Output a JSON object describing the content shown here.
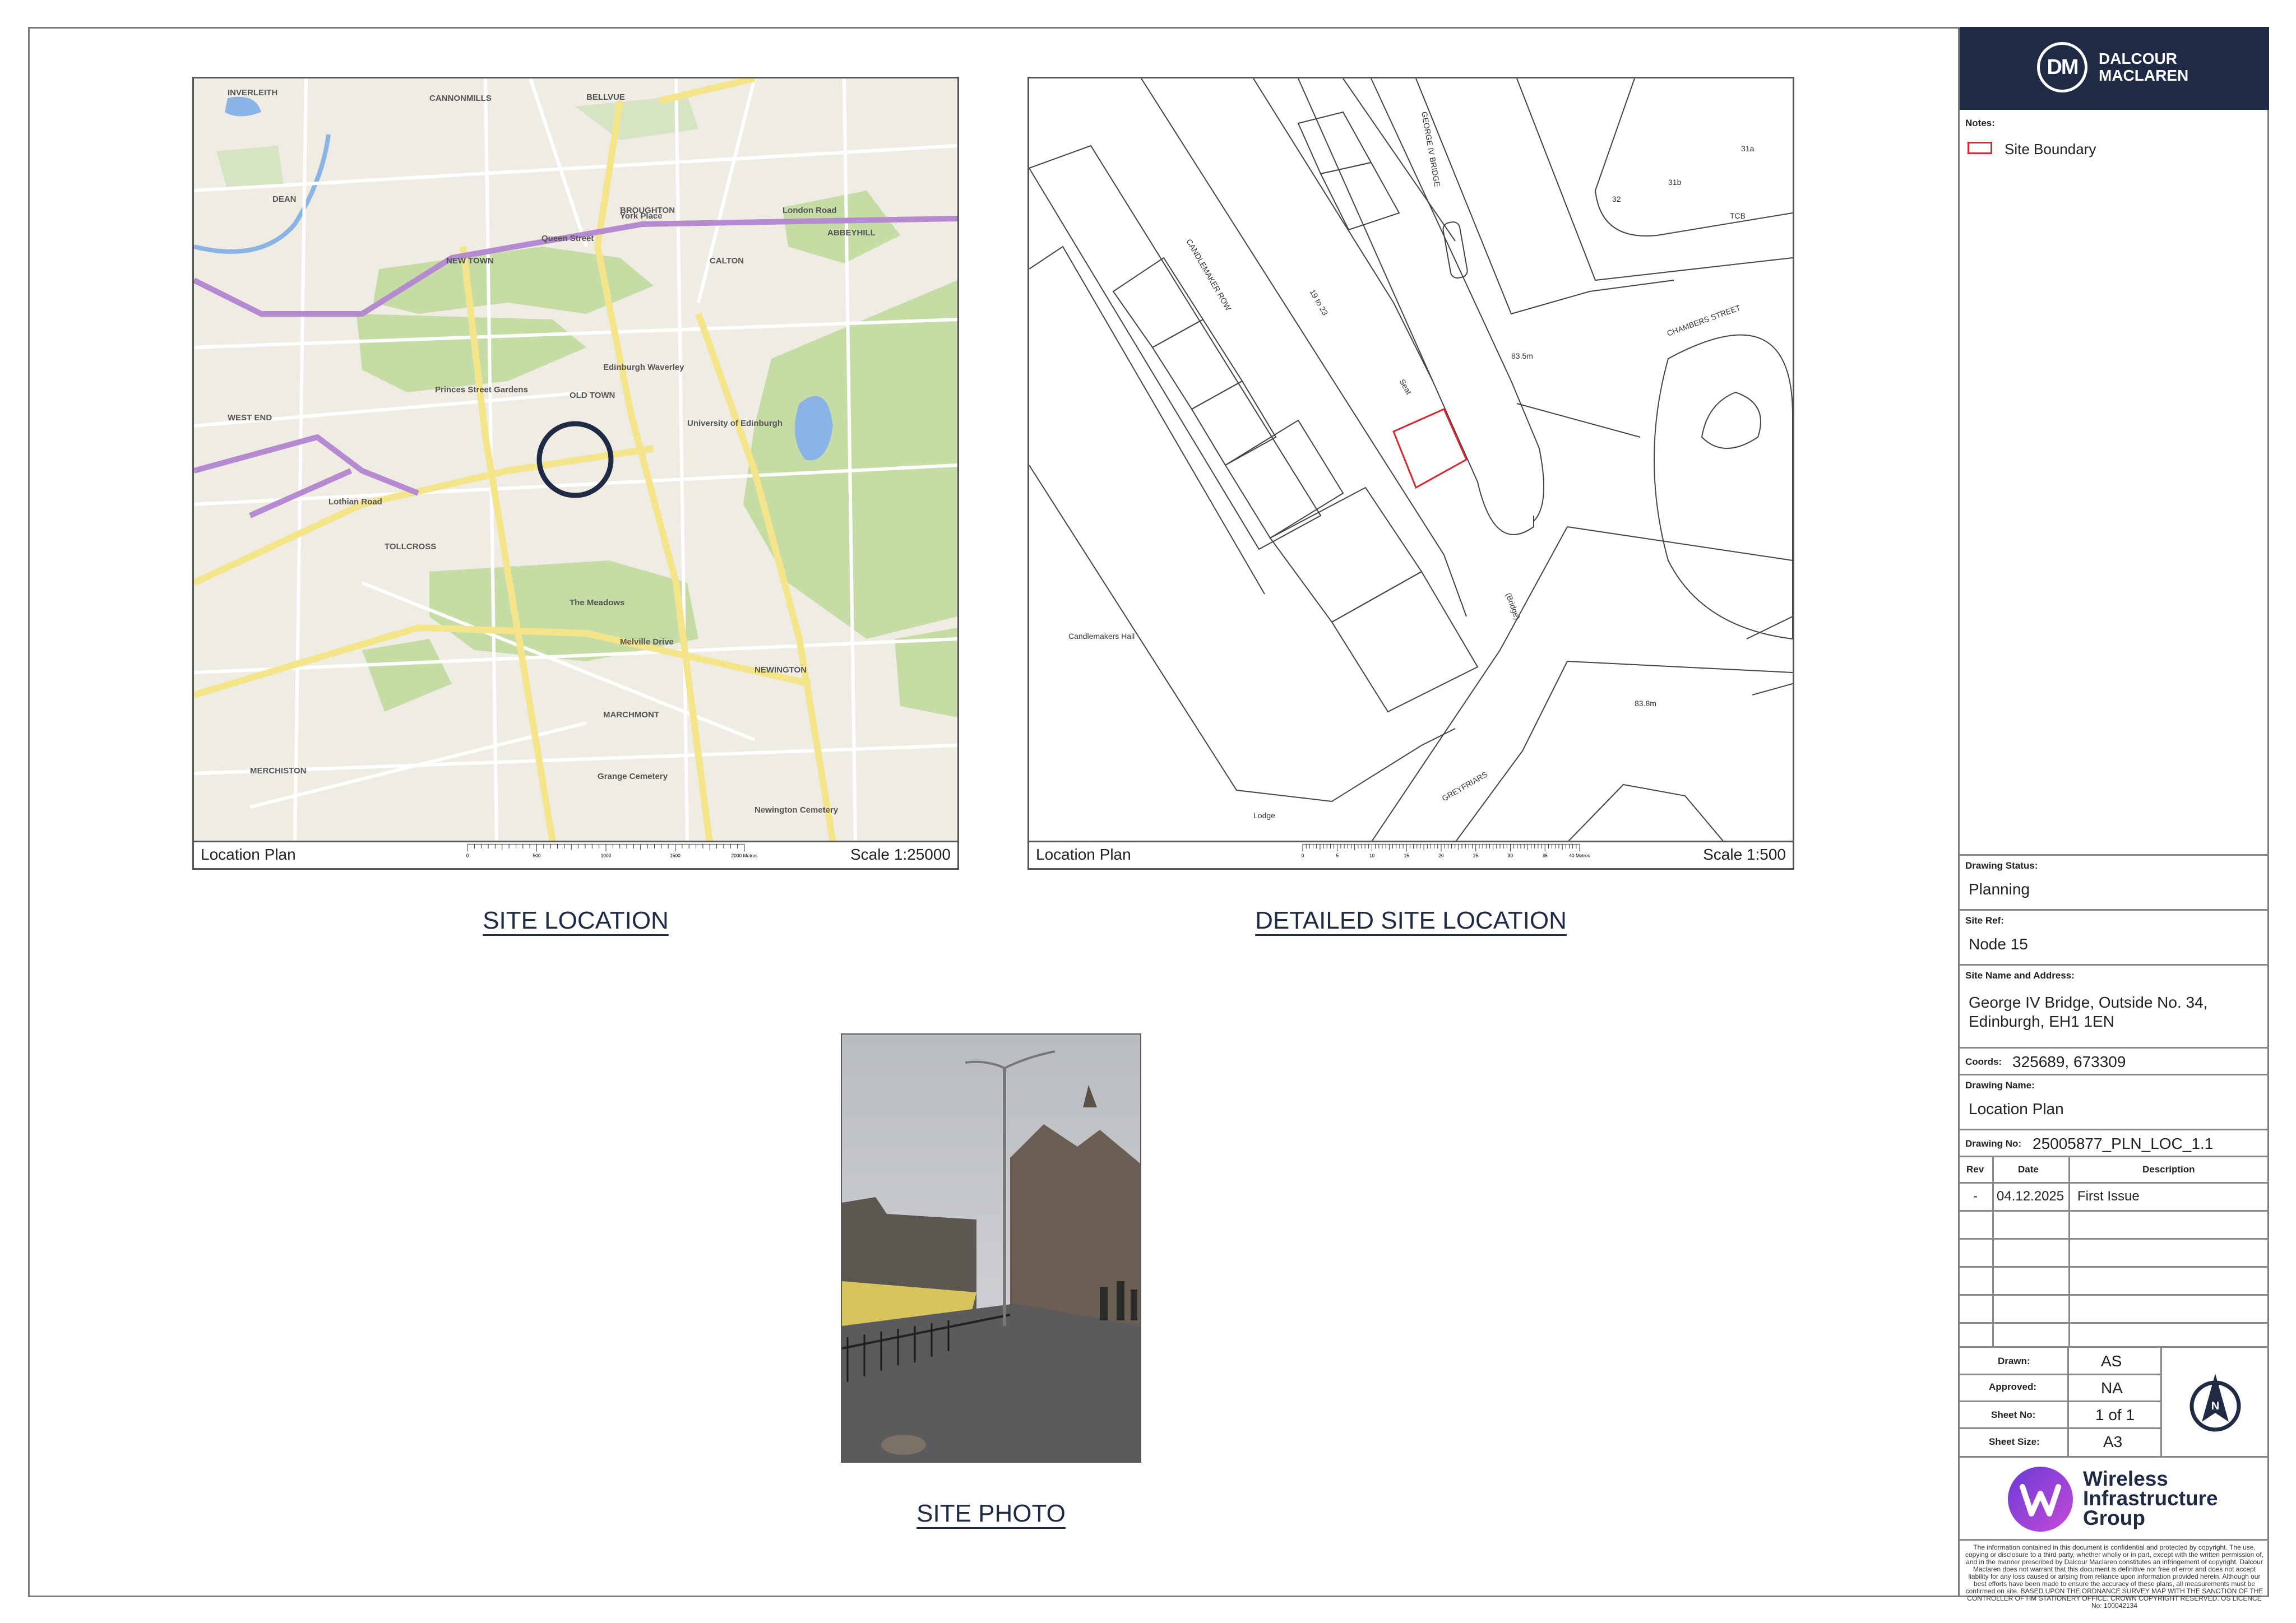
{
  "map_panel": {
    "footer_label": "Location Plan",
    "scale": "Scale 1:25000",
    "scalebar": {
      "ticks": [
        "0",
        "500",
        "1000",
        "1500",
        "2000 Metres"
      ]
    },
    "place_labels": [
      "INVERLEITH",
      "CANNONMILLS",
      "BELLVUE",
      "DEAN",
      "NEW TOWN",
      "BROUGHTON",
      "CALTON",
      "ABBEYHILL",
      "OLD TOWN",
      "WEST END",
      "TOLLCROSS",
      "MARCHMONT",
      "NEWINGTON",
      "MERCHISTON",
      "The Meadows",
      "Princes Street Gardens",
      "Edinburgh Waverley",
      "University of Edinburgh",
      "Queen Street",
      "York Place",
      "London Road",
      "Lothian Road",
      "Melville Drive",
      "Grange Cemetery",
      "Newington Cemetery"
    ]
  },
  "detail_panel": {
    "footer_label": "Location Plan",
    "scale": "Scale 1:500",
    "scalebar": {
      "ticks": [
        "0",
        "5",
        "10",
        "15",
        "20",
        "25",
        "30",
        "35",
        "40 Metres"
      ]
    },
    "labels": [
      "GEORGE IV BRIDGE",
      "CANDLEMAKER ROW",
      "CHAMBERS STREET",
      "GREYFRIARS",
      "Candlemakers Hall",
      "83.5m",
      "83.8m",
      "TCB",
      "Lodge",
      "(Bridge)",
      "31a",
      "31b",
      "32",
      "19 to 23",
      "Seat"
    ]
  },
  "captions": {
    "site_location": "SITE LOCATION",
    "detailed_site_location": "DETAILED SITE LOCATION",
    "site_photo": "SITE PHOTO"
  },
  "title_block": {
    "company": {
      "initials": "DM",
      "line1": "DALCOUR",
      "line2": "MACLAREN"
    },
    "notes_label": "Notes:",
    "legend": {
      "label": "Site Boundary",
      "color": "#d6282e"
    },
    "drawing_status_label": "Drawing Status:",
    "drawing_status": "Planning",
    "site_ref_label": "Site Ref:",
    "site_ref": "Node 15",
    "site_name_label": "Site Name and Address:",
    "site_name_line1": "George IV Bridge, Outside No. 34,",
    "site_name_line2": "Edinburgh, EH1 1EN",
    "coords_label": "Coords:",
    "coords": "325689, 673309",
    "drawing_name_label": "Drawing Name:",
    "drawing_name": "Location Plan",
    "drawing_no_label": "Drawing No:",
    "drawing_no": "25005877_PLN_LOC_1.1",
    "rev_headers": {
      "rev": "Rev",
      "date": "Date",
      "description": "Description"
    },
    "revisions": [
      {
        "rev": "-",
        "date": "04.12.2025",
        "description": "First Issue"
      }
    ],
    "drawn_label": "Drawn:",
    "drawn": "AS",
    "approved_label": "Approved:",
    "approved": "NA",
    "sheet_no_label": "Sheet No:",
    "sheet_no": "1 of 1",
    "sheet_size_label": "Sheet Size:",
    "sheet_size": "A3",
    "north_icon": "north-arrow-icon",
    "client": {
      "line1": "Wireless",
      "line2": "Infrastructure",
      "line3": "Group"
    },
    "legal_text": "The information contained in this document is confidential and protected by copyright. The use, copying or disclosure to a third party, whether wholly or in part, except with the written permission of, and in the manner prescribed by Dalcour Maclaren constitutes an infringement of copyright. Dalcour Maclaren does not warrant that this document is definitive nor free of error and does not accept liability for any loss caused or arising from reliance upon information provided herein. Although our best efforts have been made to ensure the accuracy of these plans, all measurements must be confirmed on site. BASED UPON THE ORDNANCE SURVEY MAP WITH THE SANCTION OF THE CONTROLLER OF HM STATIONERY OFFICE. CROWN COPYRIGHT RESERVED. OS LICENCE No: 100042134"
  },
  "colors": {
    "navy": "#1f2a44",
    "site_boundary": "#d6282e",
    "map_green": "#c5dca5",
    "map_road": "#f4e58a",
    "map_purple": "#b58ad1",
    "water": "#8ab4e6"
  }
}
